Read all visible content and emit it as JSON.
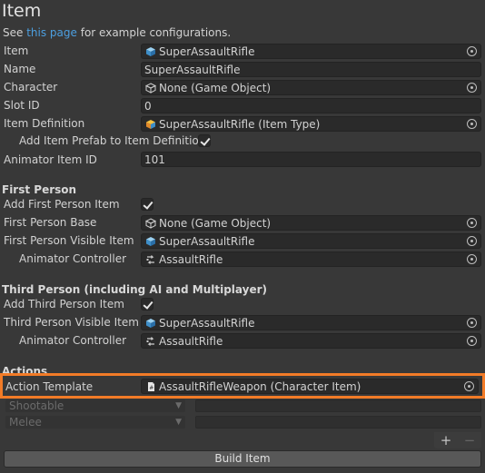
{
  "header": {
    "title": "Item",
    "see_prefix": "See",
    "see_link": "this page",
    "see_suffix": "for example configurations."
  },
  "fields": {
    "item": {
      "label": "Item",
      "value": "SuperAssaultRifle"
    },
    "name": {
      "label": "Name",
      "value": "SuperAssaultRifle"
    },
    "character": {
      "label": "Character",
      "value": "None (Game Object)"
    },
    "slot_id": {
      "label": "Slot ID",
      "value": "0"
    },
    "item_definition": {
      "label": "Item Definition",
      "value": "SuperAssaultRifle (Item Type)"
    },
    "add_prefab": {
      "label": "Add Item Prefab to Item Definition",
      "checked": true
    },
    "animator_item_id": {
      "label": "Animator Item ID",
      "value": "101"
    }
  },
  "first_person": {
    "heading": "First Person",
    "add_item": {
      "label": "Add First Person Item",
      "checked": true
    },
    "base": {
      "label": "First Person Base",
      "value": "None (Game Object)"
    },
    "visible_item": {
      "label": "First Person Visible Item",
      "value": "SuperAssaultRifle"
    },
    "animator": {
      "label": "Animator Controller",
      "value": "AssaultRifle"
    }
  },
  "third_person": {
    "heading": "Third Person (including AI and Multiplayer)",
    "add_item": {
      "label": "Add Third Person Item",
      "checked": true
    },
    "visible_item": {
      "label": "Third Person Visible Item",
      "value": "SuperAssaultRifle"
    },
    "animator": {
      "label": "Animator Controller",
      "value": "AssaultRifle"
    }
  },
  "actions": {
    "heading": "Actions",
    "template": {
      "label": "Action Template",
      "value": "AssaultRifleWeapon (Character Item)"
    },
    "dropdowns": [
      "Shootable",
      "Melee"
    ],
    "add_symbol": "+",
    "remove_symbol": "−"
  },
  "build_button": "Build Item",
  "colors": {
    "background": "#383838",
    "field_bg": "#2a2a2a",
    "highlight": "#f27b27",
    "link": "#4c9fe0",
    "button": "#585858"
  },
  "icons": {
    "prefab": "prefab-cube-icon",
    "gameobject": "gameobject-cube-icon",
    "item_type": "item-type-icon",
    "animator": "animator-controller-icon",
    "script": "script-asset-icon",
    "picker": "object-picker-icon"
  }
}
